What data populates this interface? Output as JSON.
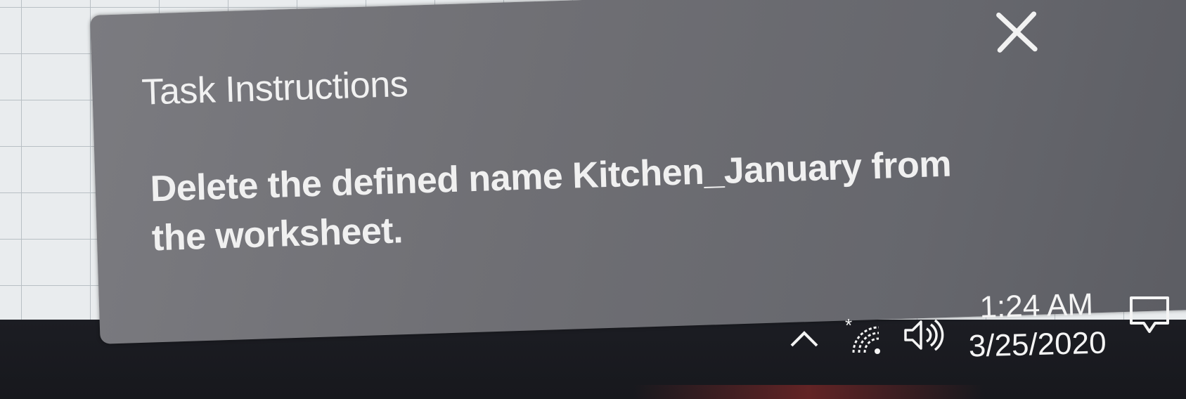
{
  "dialog": {
    "title": "Task Instructions",
    "instruction": "Delete the defined name Kitchen_January from the worksheet.",
    "close_icon": "close-icon"
  },
  "taskbar": {
    "tray_icons": [
      "chevron-up-icon",
      "network-icon",
      "volume-icon",
      "notification-icon"
    ],
    "clock": {
      "time": "1:24 AM",
      "date": "3/25/2020"
    }
  },
  "colors": {
    "dialog_background": "#6f6f74",
    "taskbar_background": "#1b1c21",
    "text": "#f1f1f1"
  }
}
